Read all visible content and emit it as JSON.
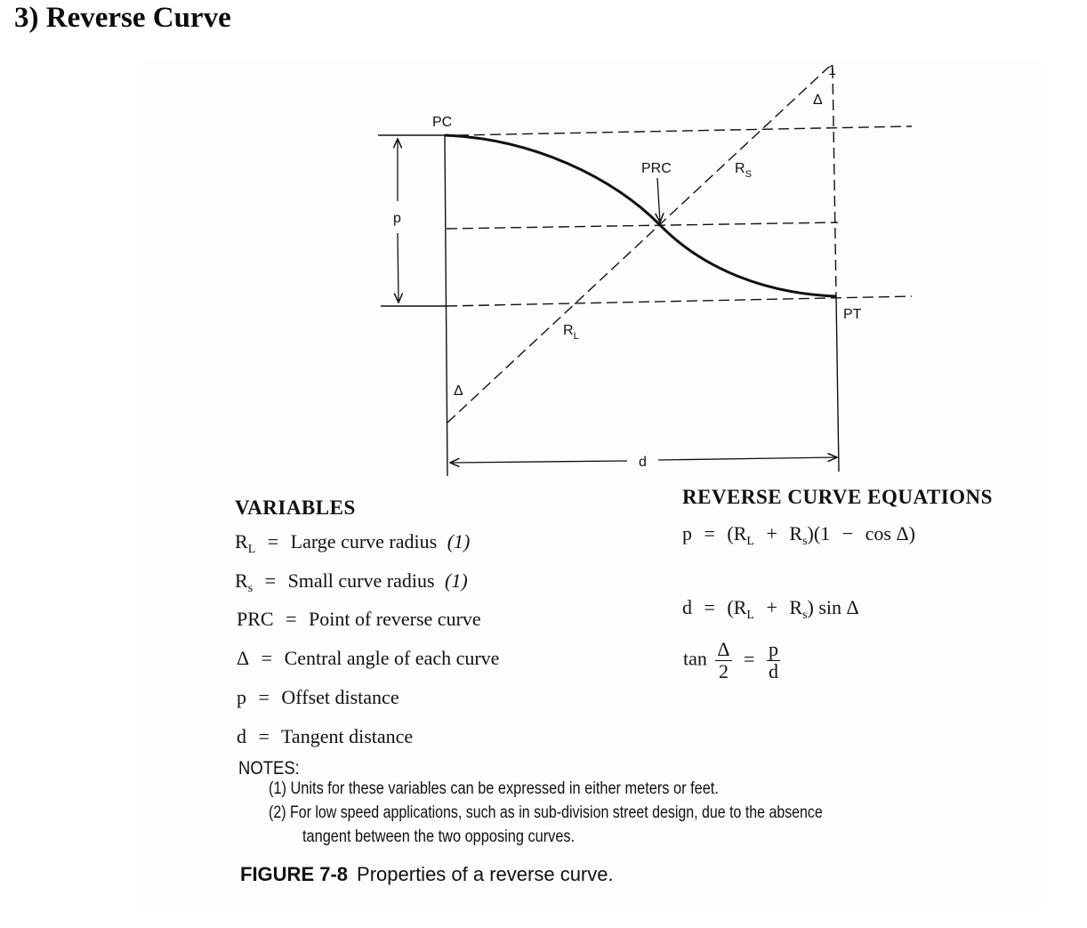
{
  "heading": "3) Reverse Curve",
  "diagram": {
    "labels": {
      "pc": "PC",
      "prc": "PRC",
      "pt": "PT",
      "p": "p",
      "d": "d",
      "rs_main": "R",
      "rs_sub": "S",
      "rl_main": "R",
      "rl_sub": "L",
      "delta_top": "Δ",
      "delta_bottom": "Δ",
      "tick_top": "1"
    }
  },
  "variables": {
    "title": "VARIABLES",
    "rows": [
      {
        "symbol": "R",
        "sub": "L",
        "equals": "=",
        "description": "Large curve radius",
        "note": "(1)"
      },
      {
        "symbol": "R",
        "sub": "s",
        "equals": "=",
        "description": "Small curve radius",
        "note": "(1)"
      },
      {
        "symbol": "PRC",
        "sub": "",
        "equals": "=",
        "description": "Point of reverse curve",
        "note": ""
      },
      {
        "symbol": "Δ",
        "sub": "",
        "equals": "=",
        "description": "Central angle of each curve",
        "note": ""
      },
      {
        "symbol": "p",
        "sub": "",
        "equals": "=",
        "description": "Offset distance",
        "note": ""
      },
      {
        "symbol": "d",
        "sub": "",
        "equals": "=",
        "description": "Tangent distance",
        "note": ""
      }
    ]
  },
  "equations": {
    "title": "REVERSE CURVE EQUATIONS",
    "eq1": {
      "lhs": "p",
      "eq": "=",
      "part1": "(R",
      "sub1": "L",
      "plus": "+",
      "part2": "R",
      "sub2": "s",
      "part3": ")(1",
      "minus": "−",
      "part4": "cos Δ)"
    },
    "eq2": {
      "lhs": "d",
      "eq": "=",
      "part1": "(R",
      "sub1": "L",
      "plus": "+",
      "part2": "R",
      "sub2": "s",
      "part3": ") sin Δ"
    },
    "eq3": {
      "func": "tan",
      "num1": "Δ",
      "den1": "2",
      "eq": "=",
      "num2": "p",
      "den2": "d"
    }
  },
  "notes": {
    "title": "NOTES:",
    "items": [
      "(1) Units for these variables can be expressed in either meters or feet.",
      "(2) For low speed applications, such as in sub-division street design, due to the absence",
      "tangent between the two opposing curves."
    ]
  },
  "caption": {
    "figure_number": "FIGURE 7-8",
    "text": "Properties of a reverse curve."
  }
}
